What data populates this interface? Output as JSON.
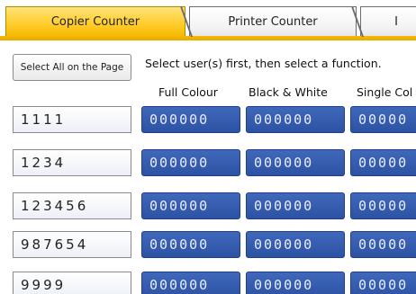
{
  "tabs": [
    {
      "label": "Copier Counter",
      "active": true
    },
    {
      "label": "Printer Counter",
      "active": false
    },
    {
      "label": "I",
      "active": false
    }
  ],
  "toolbar": {
    "select_all_label": "Select All on the Page",
    "instruction": "Select user(s) first, then select a function."
  },
  "columns": [
    "Full Colour",
    "Black & White",
    "Single Col"
  ],
  "rows": [
    {
      "user": "1111",
      "counters": [
        "000000",
        "000000",
        "00000"
      ]
    },
    {
      "user": "1234",
      "counters": [
        "000000",
        "000000",
        "00000"
      ]
    },
    {
      "user": "123456",
      "counters": [
        "000000",
        "000000",
        "00000"
      ]
    },
    {
      "user": "987654",
      "counters": [
        "000000",
        "000000",
        "00000"
      ]
    },
    {
      "user": "9999",
      "counters": [
        "000000",
        "000000",
        "00000"
      ]
    }
  ],
  "colors": {
    "active_tab": "#ffce2e",
    "tab_underline": "#f0b400",
    "counter_bg": "#3a5fb0",
    "counter_text": "#e8eefc"
  }
}
